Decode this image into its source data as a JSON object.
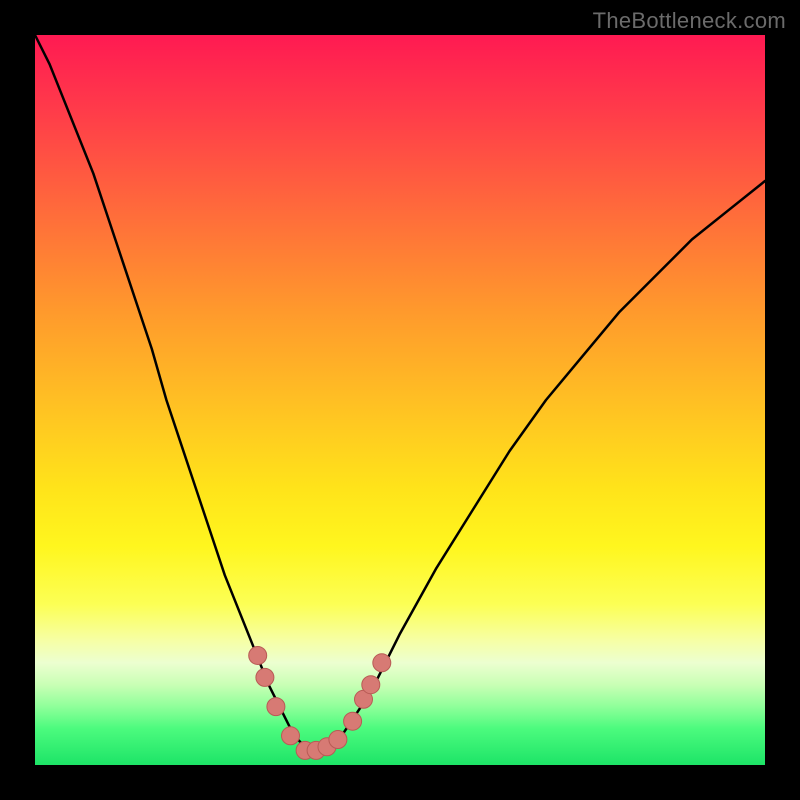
{
  "watermark": "TheBottleneck.com",
  "colors": {
    "frame": "#000000",
    "curve": "#000000",
    "marker_fill": "#d77a74",
    "marker_stroke": "#b85b55",
    "gradient_top": "#ff1a52",
    "gradient_bottom": "#1de467"
  },
  "chart_data": {
    "type": "line",
    "title": "",
    "xlabel": "",
    "ylabel": "",
    "xlim": [
      0,
      100
    ],
    "ylim": [
      0,
      100
    ],
    "x": [
      0,
      2,
      4,
      6,
      8,
      10,
      12,
      14,
      16,
      18,
      20,
      22,
      24,
      26,
      28,
      30,
      32,
      33,
      34,
      35,
      36,
      37,
      38,
      39,
      40,
      42,
      44,
      46,
      48,
      50,
      55,
      60,
      65,
      70,
      75,
      80,
      85,
      90,
      95,
      100
    ],
    "values": [
      100,
      96,
      91,
      86,
      81,
      75,
      69,
      63,
      57,
      50,
      44,
      38,
      32,
      26,
      21,
      16,
      11,
      9,
      7,
      5,
      3.5,
      2.5,
      2,
      2,
      2.5,
      4,
      7,
      10,
      14,
      18,
      27,
      35,
      43,
      50,
      56,
      62,
      67,
      72,
      76,
      80
    ],
    "markers": [
      {
        "x": 30.5,
        "y": 15
      },
      {
        "x": 31.5,
        "y": 12
      },
      {
        "x": 33.0,
        "y": 8
      },
      {
        "x": 35.0,
        "y": 4
      },
      {
        "x": 37.0,
        "y": 2
      },
      {
        "x": 38.5,
        "y": 2
      },
      {
        "x": 40.0,
        "y": 2.5
      },
      {
        "x": 41.5,
        "y": 3.5
      },
      {
        "x": 43.5,
        "y": 6
      },
      {
        "x": 45.0,
        "y": 9
      },
      {
        "x": 46.0,
        "y": 11
      },
      {
        "x": 47.5,
        "y": 14
      }
    ],
    "marker_radius_px": 9
  }
}
